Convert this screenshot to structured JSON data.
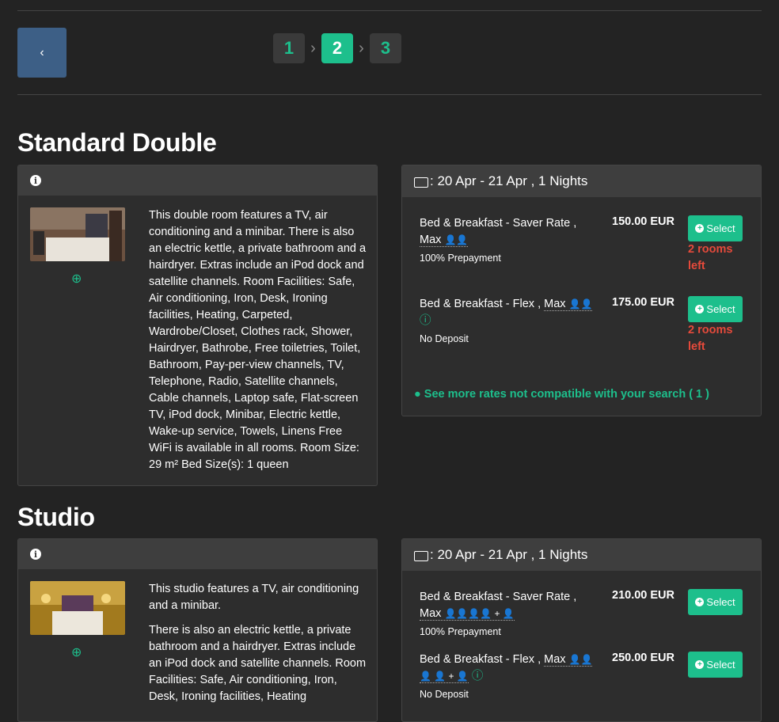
{
  "nav": {
    "back_icon": "chevron-left-icon",
    "steps": [
      "1",
      "2",
      "3"
    ],
    "step_sep": "›",
    "active_step": 2
  },
  "rooms": [
    {
      "title": "Standard Double",
      "info_icon": "info-icon",
      "description": [
        "This double room features a TV, air conditioning and a minibar. There is also an electric kettle, a private bathroom and a hairdryer. Extras include an iPod dock and satellite channels. Room Facilities: Safe, Air conditioning, Iron, Desk, Ironing facilities, Heating, Carpeted, Wardrobe/Closet, Clothes rack, Shower, Hairdryer, Bathrobe, Free toiletries, Toilet, Bathroom, Pay-per-view channels, TV, Telephone, Radio, Satellite channels, Cable channels, Laptop safe, Flat-screen TV, iPod dock, Minibar, Electric kettle, Wake-up service, Towels, Linens Free WiFi is available in all rooms. Room Size: 29 m² Bed Size(s): 1 queen"
      ],
      "dates": ": 20 Apr - 21 Apr , 1 Nights",
      "rates": [
        {
          "name": "Bed & Breakfast - Saver Rate ,",
          "max": "Max",
          "guests": "👤👤",
          "cond": "100% Prepayment",
          "price": "150.00 EUR",
          "select": "Select",
          "left": "2 rooms left"
        },
        {
          "name": "Bed & Breakfast - Flex ,",
          "max": "Max",
          "guests": "👤👤",
          "cond": "No Deposit",
          "price": "175.00 EUR",
          "select": "Select",
          "left": "2 rooms left"
        }
      ],
      "see_more": "See more rates not compatible with your search ( 1 )"
    },
    {
      "title": "Studio",
      "info_icon": "info-icon",
      "description": [
        "This studio features a TV, air conditioning and a minibar.",
        "There is also an electric kettle, a private bathroom and a hairdryer. Extras include an iPod dock and satellite channels. Room Facilities: Safe, Air conditioning, Iron, Desk, Ironing facilities, Heating"
      ],
      "dates": ": 20 Apr - 21 Apr , 1 Nights",
      "rates": [
        {
          "name": "Bed & Breakfast - Saver Rate ,",
          "max": "Max",
          "guests": "👤👤👤👤 + 👤",
          "cond": "100% Prepayment",
          "price": "210.00 EUR",
          "select": "Select"
        },
        {
          "name": "Bed & Breakfast - Flex ,",
          "max": "Max",
          "guests": "👤👤👤 👤 + 👤",
          "cond": "No Deposit",
          "price": "250.00 EUR",
          "select": "Select"
        }
      ]
    }
  ],
  "colors": {
    "accent": "#1dbf8c",
    "warning": "#e64a3b",
    "back_button": "#3d5f86",
    "background": "#232323"
  }
}
